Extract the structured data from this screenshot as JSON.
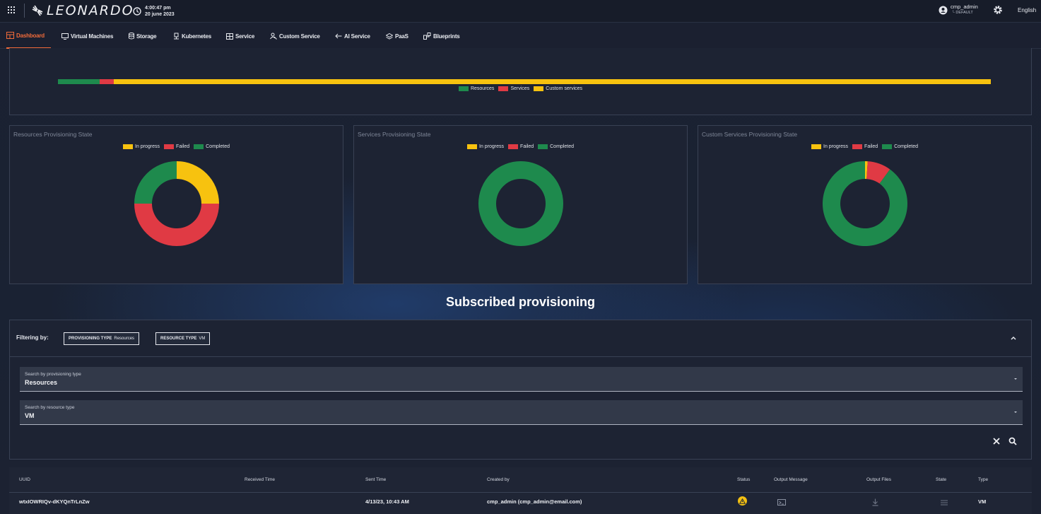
{
  "colors": {
    "accent": "#f26b3a",
    "green": "#1e8a4d",
    "red": "#e03a44",
    "yellow": "#f7c20f"
  },
  "topbar": {
    "logo": "LEONARDO",
    "time": "4:00:47 pm",
    "date": "20 june 2023",
    "user": "cmp_admin",
    "tenant": "└ DEFAULT",
    "language": "English"
  },
  "nav": [
    {
      "label": "Dashboard",
      "icon": "dashboard-icon",
      "active": true
    },
    {
      "label": "Virtual Machines",
      "icon": "monitor-icon"
    },
    {
      "label": "Storage",
      "icon": "database-icon"
    },
    {
      "label": "Kubernetes",
      "icon": "kubernetes-icon"
    },
    {
      "label": "Service",
      "icon": "service-grid-icon"
    },
    {
      "label": "Custom Service",
      "icon": "custom-service-icon"
    },
    {
      "label": "AI Service",
      "icon": "ai-service-icon"
    },
    {
      "label": "PaaS",
      "icon": "layers-icon"
    },
    {
      "label": "Blueprints",
      "icon": "blueprints-icon"
    }
  ],
  "overview": {
    "segments": [
      {
        "name": "Resources",
        "fraction": 0.045
      },
      {
        "name": "Services",
        "fraction": 0.015
      },
      {
        "name": "Custom services",
        "fraction": 0.94
      }
    ],
    "legend": [
      "Resources",
      "Services",
      "Custom services"
    ]
  },
  "donuts": [
    {
      "title": "Resources Provisioning State",
      "legend": [
        "In progress",
        "Failed",
        "Completed"
      ],
      "slices": {
        "in_progress": 0.25,
        "failed": 0.5,
        "completed": 0.25
      }
    },
    {
      "title": "Services Provisioning State",
      "legend": [
        "In progress",
        "Failed",
        "Completed"
      ],
      "slices": {
        "in_progress": 0,
        "failed": 0,
        "completed": 1
      }
    },
    {
      "title": "Custom Services Provisioning State",
      "legend": [
        "In progress",
        "Failed",
        "Completed"
      ],
      "slices": {
        "in_progress": 0.01,
        "failed": 0.09,
        "completed": 0.9
      }
    }
  ],
  "section_title": "Subscribed provisioning",
  "filters": {
    "label": "Filtering by:",
    "chips": [
      {
        "key": "PROVISIONING TYPE",
        "value": "Resources"
      },
      {
        "key": "RESOURCE TYPE",
        "value": "VM"
      }
    ],
    "fields": [
      {
        "label": "Search by provisioning type",
        "value": "Resources"
      },
      {
        "label": "Search by resource type",
        "value": "VM"
      }
    ]
  },
  "table": {
    "columns": [
      "UUID",
      "Received Time",
      "Sent Time",
      "Created by",
      "Status",
      "Output Message",
      "Output Files",
      "State",
      "Type"
    ],
    "rows": [
      {
        "uuid": "wtxIOWRIQv-dKYQnTrLnZw",
        "received": "",
        "sent": "4/13/23, 10:43 AM",
        "created_by": "cmp_admin (cmp_admin@email.com)",
        "status": "warning-icon",
        "type": "VM"
      }
    ]
  }
}
